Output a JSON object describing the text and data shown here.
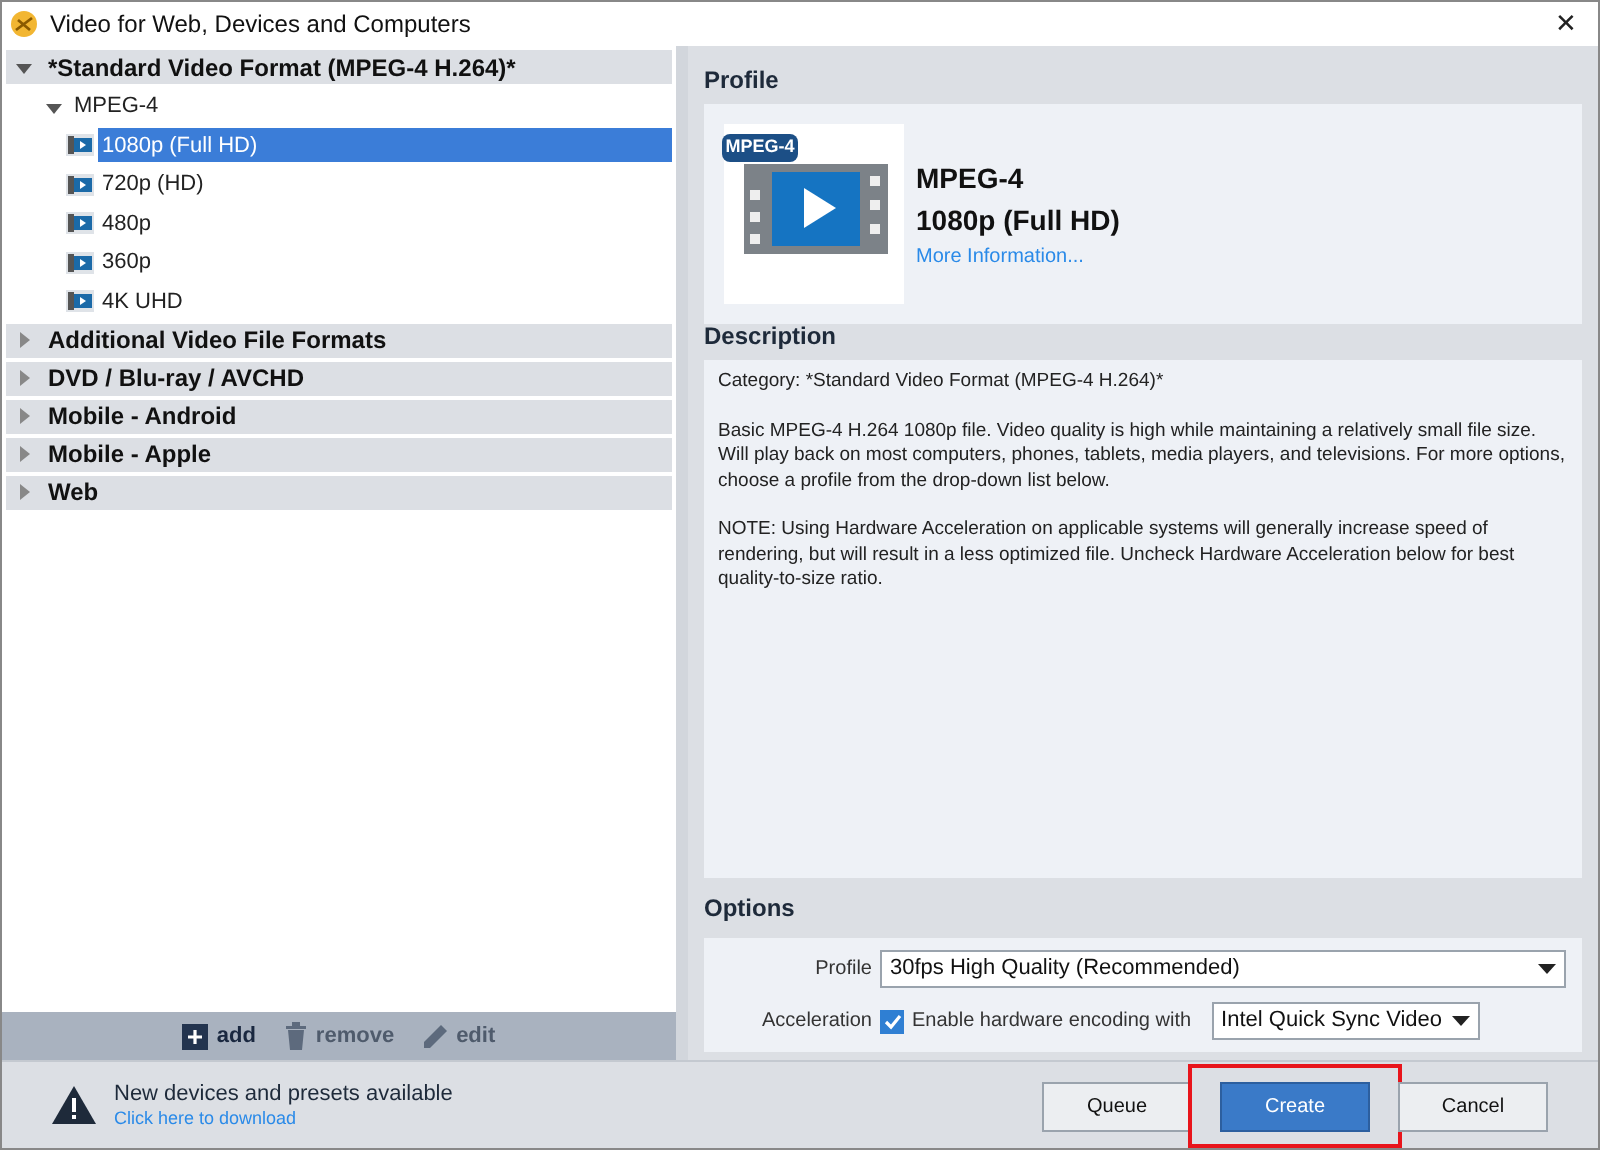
{
  "window": {
    "title": "Video for Web, Devices and Computers",
    "close": "✕"
  },
  "tree": [
    {
      "label": "*Standard Video Format (MPEG-4 H.264)*",
      "expanded": true,
      "children": [
        {
          "label": "MPEG-4",
          "expanded": true,
          "children": [
            {
              "label": "1080p (Full HD)",
              "selected": true
            },
            {
              "label": "720p (HD)",
              "selected": false
            },
            {
              "label": "480p",
              "selected": false
            },
            {
              "label": "360p",
              "selected": false
            },
            {
              "label": "4K UHD",
              "selected": false
            }
          ]
        }
      ]
    },
    {
      "label": "Additional Video File Formats",
      "expanded": false
    },
    {
      "label": "DVD / Blu-ray / AVCHD",
      "expanded": false
    },
    {
      "label": "Mobile - Android",
      "expanded": false
    },
    {
      "label": "Mobile - Apple",
      "expanded": false
    },
    {
      "label": "Web",
      "expanded": false
    }
  ],
  "tree_toolbar": [
    {
      "kind": "add",
      "label": "add",
      "disabled": false
    },
    {
      "kind": "remove",
      "label": "remove",
      "disabled": true
    },
    {
      "kind": "edit",
      "label": "edit",
      "disabled": true
    }
  ],
  "profile": {
    "heading": "Profile",
    "badge": "MPEG-4",
    "format": "MPEG-4",
    "name": "1080p (Full HD)",
    "link": "More Information..."
  },
  "description": {
    "heading": "Description",
    "paragraphs": [
      "Category: *Standard Video Format (MPEG-4 H.264)*",
      "Basic MPEG-4 H.264 1080p file. Video quality is high while maintaining a relatively small file size. Will play back on most computers, phones, tablets, media players, and televisions. For more options, choose a profile from the drop-down list below.",
      "NOTE: Using Hardware Acceleration on applicable systems will generally increase speed of rendering, but will result in a less optimized file. Uncheck Hardware Acceleration below for best quality-to-size ratio."
    ]
  },
  "options": {
    "heading": "Options",
    "profile_label": "Profile",
    "profile_value": "30fps High Quality (Recommended)",
    "acceleration_label": "Acceleration",
    "hw_checkbox": {
      "label": "Enable hardware encoding with",
      "checked": true
    },
    "encoder_value": "Intel Quick Sync Video"
  },
  "notice": {
    "title": "New devices and presets available",
    "link": "Click here to download"
  },
  "buttons": [
    {
      "label": "Queue",
      "primary": false,
      "highlighted": false
    },
    {
      "label": "Create",
      "primary": true,
      "highlighted": true
    },
    {
      "label": "Cancel",
      "primary": false,
      "highlighted": false
    }
  ]
}
